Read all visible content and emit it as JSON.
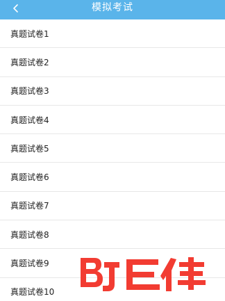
{
  "header": {
    "title": "模拟考试",
    "back_icon": "chevron-left-icon",
    "background_color": "#5ab4ea"
  },
  "list": {
    "items": [
      {
        "label": "真题试卷1"
      },
      {
        "label": "真题试卷2"
      },
      {
        "label": "真题试卷3"
      },
      {
        "label": "真题试卷4"
      },
      {
        "label": "真题试卷5"
      },
      {
        "label": "真题试卷6"
      },
      {
        "label": "真题试卷7"
      },
      {
        "label": "真题试卷8"
      },
      {
        "label": "真题试卷9"
      },
      {
        "label": "真题试卷10"
      }
    ]
  },
  "watermark": {
    "text": "巨佳",
    "logo_mark": "BJ",
    "color": "#f23c32"
  }
}
